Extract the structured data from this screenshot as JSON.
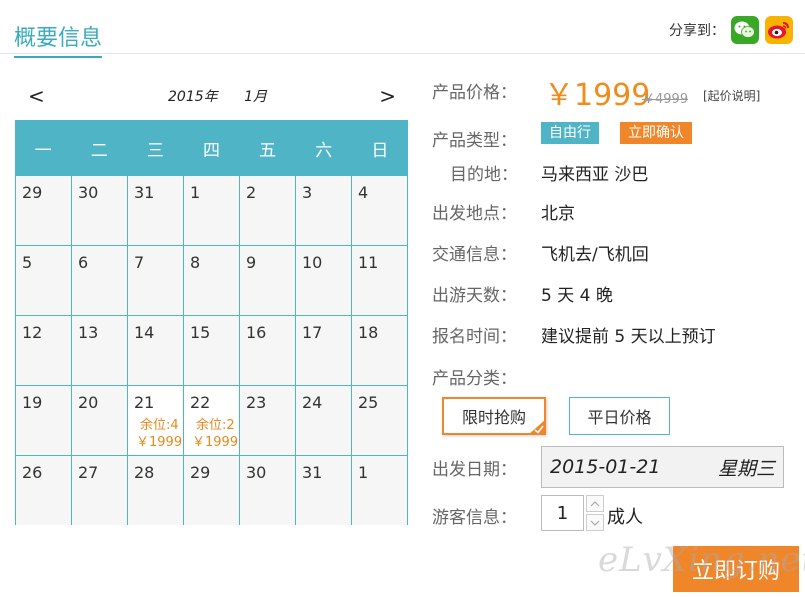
{
  "header": {
    "title": "概要信息",
    "share_label": "分享到："
  },
  "calendar": {
    "prev": "<",
    "next": ">",
    "year": "2015年",
    "month": "1月",
    "weekdays": [
      "一",
      "二",
      "三",
      "四",
      "五",
      "六",
      "日"
    ],
    "days": [
      {
        "d": "29"
      },
      {
        "d": "30"
      },
      {
        "d": "31"
      },
      {
        "d": "1"
      },
      {
        "d": "2"
      },
      {
        "d": "3"
      },
      {
        "d": "4"
      },
      {
        "d": "5"
      },
      {
        "d": "6"
      },
      {
        "d": "7"
      },
      {
        "d": "8"
      },
      {
        "d": "9"
      },
      {
        "d": "10"
      },
      {
        "d": "11"
      },
      {
        "d": "12"
      },
      {
        "d": "13"
      },
      {
        "d": "14"
      },
      {
        "d": "15"
      },
      {
        "d": "16"
      },
      {
        "d": "17"
      },
      {
        "d": "18"
      },
      {
        "d": "19"
      },
      {
        "d": "20"
      },
      {
        "d": "21",
        "seats": "余位:4",
        "price": "￥1999"
      },
      {
        "d": "22",
        "seats": "余位:2",
        "price": "￥1999"
      },
      {
        "d": "23"
      },
      {
        "d": "24"
      },
      {
        "d": "25"
      },
      {
        "d": "26"
      },
      {
        "d": "27"
      },
      {
        "d": "28"
      },
      {
        "d": "29"
      },
      {
        "d": "30"
      },
      {
        "d": "31"
      },
      {
        "d": "1"
      }
    ]
  },
  "info": {
    "price_label": "产品价格：",
    "price": "￥1999",
    "price_old": "￥4999",
    "price_note": "[起价说明]",
    "type_label": "产品类型：",
    "tag1": "自由行",
    "tag2": "立即确认",
    "dest_label": "目的地：",
    "dest": "马来西亚 沙巴",
    "depart_label": "出发地点：",
    "depart": "北京",
    "transport_label": "交通信息：",
    "transport": "飞机去/飞机回",
    "days_label": "出游天数：",
    "days": "5 天 4 晚",
    "signup_label": "报名时间：",
    "signup": "建议提前 5 天以上预订",
    "category_label": "产品分类：",
    "cat_active": "限时抢购",
    "cat_plain": "平日价格",
    "date_label": "出发日期：",
    "date_value": "2015-01-21",
    "weekday_value": "星期三",
    "guest_label": "游客信息：",
    "qty": "1",
    "qty_unit": "成人",
    "buy": "立即订购"
  },
  "watermark": "eLvXing.net",
  "colors": {
    "accent": "#4fb5c6",
    "orange": "#f0862a"
  }
}
